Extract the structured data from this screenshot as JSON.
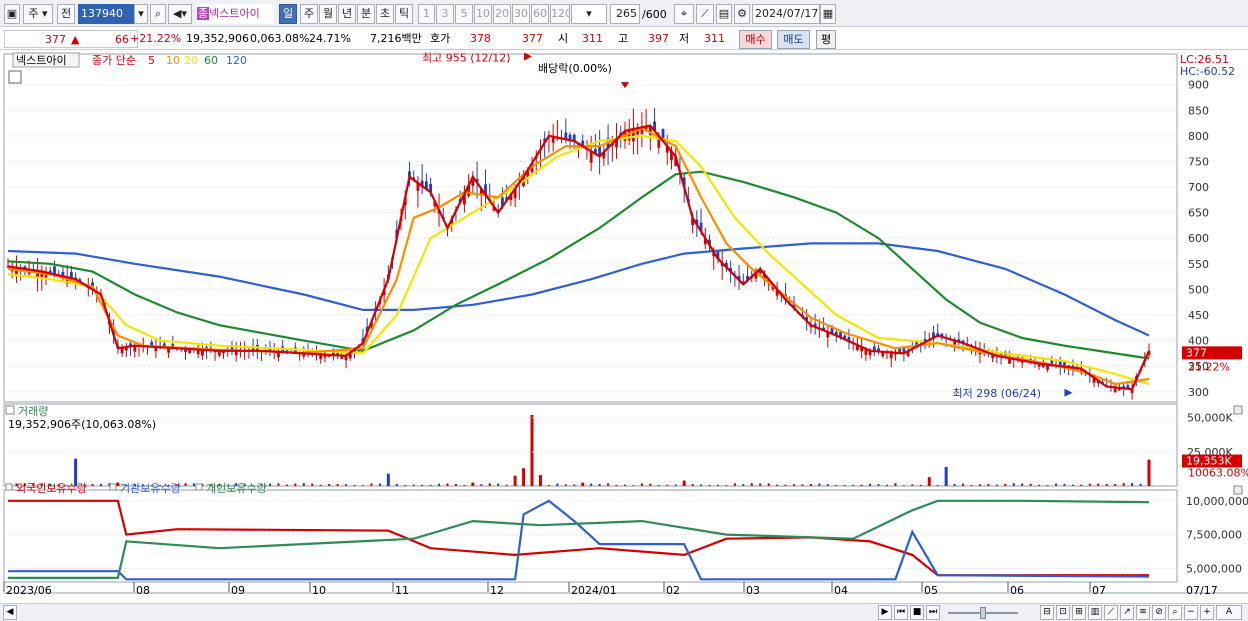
{
  "toolbar": {
    "market_label": "주",
    "prev_label": "전",
    "stock_code": "137940",
    "stock_badge": "종",
    "stock_name": "넥스트아이",
    "period_buttons": [
      "일",
      "주",
      "월",
      "년",
      "분",
      "초",
      "틱"
    ],
    "selected_period": "일",
    "interval_buttons": [
      "1",
      "3",
      "5",
      "10",
      "20",
      "30",
      "60",
      "120"
    ],
    "bar_count": "265",
    "bar_total": "/600",
    "date": "2024/07/17"
  },
  "quote": {
    "price": "377",
    "change": "66",
    "change_pct": "+21.22%",
    "volume": "19,352,906",
    "volume_pct": "0,063.08%",
    "turnover": "24.71%",
    "amount": "7,216백만",
    "quote_label": "호가",
    "ask": "378",
    "bid": "377",
    "open_label": "시",
    "open": "311",
    "high_label": "고",
    "high": "397",
    "low_label": "저",
    "low": "311",
    "buy_label": "매수",
    "sell_label": "매도",
    "eval_label": "평"
  },
  "price_panel": {
    "stock_tag": "넥스트아이",
    "ma_label": "종가 단순",
    "ma_periods": [
      "5",
      "10",
      "20",
      "60",
      "120"
    ],
    "ma_colors": [
      "#d40000",
      "#ff8c00",
      "#f2e600",
      "#1e8a2e",
      "#2f5fd0"
    ],
    "high_marker": "최고 955 (12/12)",
    "dividend_marker": "배당락(0.00%)",
    "low_marker": "최저 298 (06/24)",
    "lc_label": "LC:26.51",
    "hc_label": "HC:-60.52",
    "current_price_tag": "377",
    "current_pct_tag": "21.22%",
    "y_ticks": [
      "900",
      "850",
      "800",
      "750",
      "700",
      "650",
      "600",
      "550",
      "500",
      "450",
      "400",
      "350",
      "300"
    ]
  },
  "volume_panel": {
    "title": "거래량",
    "value_label": "19,352,906주(10,063.08%)",
    "y_ticks": [
      "50,000K",
      "25,000K"
    ],
    "current_tag": "19,353K",
    "current_pct_tag": "10063.08%"
  },
  "holdings_panel": {
    "legend": [
      "외국인보유수량",
      "기관보유수량",
      "개인보유수량"
    ],
    "legend_colors": [
      "#d40000",
      "#2f5fd0",
      "#2e8b57"
    ],
    "y_ticks": [
      "10,000,000",
      "7,500,000",
      "5,000,000"
    ]
  },
  "x_axis": {
    "labels": [
      "2023/06",
      "08",
      "09",
      "10",
      "11",
      "12",
      "2024/01",
      "02",
      "03",
      "04",
      "05",
      "06",
      "07"
    ],
    "end_label": "07/17"
  },
  "chart_data": [
    {
      "type": "candlestick",
      "title": "넥스트아이",
      "ylim": [
        280,
        960
      ],
      "annotations": [
        {
          "label": "최고 955 (12/12)",
          "value": 955
        },
        {
          "label": "배당락(0.00%)"
        },
        {
          "label": "최저 298 (06/24)",
          "value": 298
        }
      ],
      "series": [
        {
          "name": "5",
          "points": [
            [
              0,
              545
            ],
            [
              8,
              535
            ],
            [
              16,
              520
            ],
            [
              22,
              490
            ],
            [
              26,
              385
            ],
            [
              30,
              390
            ],
            [
              40,
              385
            ],
            [
              50,
              380
            ],
            [
              60,
              380
            ],
            [
              70,
              375
            ],
            [
              80,
              370
            ],
            [
              84,
              395
            ],
            [
              90,
              520
            ],
            [
              95,
              720
            ],
            [
              100,
              690
            ],
            [
              104,
              620
            ],
            [
              110,
              720
            ],
            [
              116,
              650
            ],
            [
              122,
              720
            ],
            [
              128,
              800
            ],
            [
              134,
              790
            ],
            [
              140,
              760
            ],
            [
              146,
              810
            ],
            [
              152,
              820
            ],
            [
              158,
              760
            ],
            [
              162,
              640
            ],
            [
              168,
              560
            ],
            [
              174,
              510
            ],
            [
              178,
              540
            ],
            [
              184,
              480
            ],
            [
              190,
              430
            ],
            [
              196,
              410
            ],
            [
              204,
              380
            ],
            [
              212,
              375
            ],
            [
              220,
              410
            ],
            [
              226,
              395
            ],
            [
              234,
              370
            ],
            [
              244,
              355
            ],
            [
              254,
              345
            ],
            [
              260,
              310
            ],
            [
              266,
              305
            ],
            [
              270,
              380
            ]
          ]
        },
        {
          "name": "10",
          "points": [
            [
              0,
              540
            ],
            [
              10,
              530
            ],
            [
              20,
              505
            ],
            [
              26,
              410
            ],
            [
              32,
              390
            ],
            [
              50,
              382
            ],
            [
              70,
              376
            ],
            [
              84,
              385
            ],
            [
              92,
              520
            ],
            [
              96,
              640
            ],
            [
              102,
              660
            ],
            [
              108,
              690
            ],
            [
              116,
              680
            ],
            [
              124,
              740
            ],
            [
              132,
              780
            ],
            [
              140,
              780
            ],
            [
              150,
              815
            ],
            [
              158,
              780
            ],
            [
              164,
              680
            ],
            [
              170,
              590
            ],
            [
              176,
              540
            ],
            [
              182,
              500
            ],
            [
              190,
              445
            ],
            [
              198,
              415
            ],
            [
              210,
              385
            ],
            [
              220,
              395
            ],
            [
              232,
              375
            ],
            [
              246,
              355
            ],
            [
              256,
              335
            ],
            [
              262,
              315
            ],
            [
              270,
              325
            ]
          ]
        },
        {
          "name": "20",
          "points": [
            [
              0,
              530
            ],
            [
              10,
              520
            ],
            [
              20,
              505
            ],
            [
              28,
              430
            ],
            [
              36,
              400
            ],
            [
              50,
              390
            ],
            [
              70,
              382
            ],
            [
              84,
              375
            ],
            [
              92,
              450
            ],
            [
              100,
              600
            ],
            [
              110,
              650
            ],
            [
              120,
              700
            ],
            [
              130,
              760
            ],
            [
              140,
              790
            ],
            [
              150,
              800
            ],
            [
              158,
              790
            ],
            [
              164,
              740
            ],
            [
              172,
              640
            ],
            [
              180,
              570
            ],
            [
              188,
              510
            ],
            [
              196,
              450
            ],
            [
              206,
              405
            ],
            [
              220,
              395
            ],
            [
              236,
              375
            ],
            [
              250,
              360
            ],
            [
              262,
              335
            ],
            [
              270,
              315
            ]
          ]
        },
        {
          "name": "60",
          "points": [
            [
              0,
              555
            ],
            [
              10,
              550
            ],
            [
              20,
              535
            ],
            [
              30,
              490
            ],
            [
              40,
              455
            ],
            [
              50,
              430
            ],
            [
              60,
              415
            ],
            [
              70,
              400
            ],
            [
              84,
              380
            ],
            [
              96,
              420
            ],
            [
              106,
              470
            ],
            [
              116,
              510
            ],
            [
              128,
              560
            ],
            [
              140,
              620
            ],
            [
              150,
              680
            ],
            [
              158,
              725
            ],
            [
              164,
              730
            ],
            [
              174,
              710
            ],
            [
              186,
              680
            ],
            [
              196,
              650
            ],
            [
              206,
              600
            ],
            [
              214,
              540
            ],
            [
              222,
              480
            ],
            [
              230,
              435
            ],
            [
              240,
              405
            ],
            [
              250,
              390
            ],
            [
              262,
              375
            ],
            [
              270,
              365
            ]
          ]
        },
        {
          "name": "120",
          "points": [
            [
              0,
              575
            ],
            [
              16,
              570
            ],
            [
              30,
              550
            ],
            [
              50,
              525
            ],
            [
              70,
              490
            ],
            [
              84,
              460
            ],
            [
              96,
              460
            ],
            [
              110,
              470
            ],
            [
              124,
              490
            ],
            [
              138,
              520
            ],
            [
              150,
              550
            ],
            [
              160,
              570
            ],
            [
              174,
              580
            ],
            [
              190,
              590
            ],
            [
              206,
              590
            ],
            [
              220,
              575
            ],
            [
              236,
              540
            ],
            [
              250,
              490
            ],
            [
              262,
              440
            ],
            [
              270,
              410
            ]
          ]
        }
      ]
    },
    {
      "type": "bar",
      "title": "거래량",
      "ylim": [
        0,
        60000
      ],
      "y_unit": "K",
      "values": [
        [
          16,
          20000
        ],
        [
          26,
          2500
        ],
        [
          90,
          9000
        ],
        [
          110,
          2500
        ],
        [
          120,
          7500
        ],
        [
          122,
          13000
        ],
        [
          124,
          52000
        ],
        [
          126,
          8000
        ],
        [
          136,
          2500
        ],
        [
          160,
          4000
        ],
        [
          218,
          6500
        ],
        [
          222,
          14000
        ],
        [
          270,
          19353
        ]
      ]
    },
    {
      "type": "line",
      "title": "외국인/기관/개인 보유수량",
      "ylim": [
        4000000,
        10800000
      ],
      "series": [
        {
          "name": "외국인보유수량",
          "points": [
            [
              0,
              10000000
            ],
            [
              26,
              10000000
            ],
            [
              28,
              7500000
            ],
            [
              40,
              7900000
            ],
            [
              90,
              7800000
            ],
            [
              100,
              6500000
            ],
            [
              120,
              6000000
            ],
            [
              140,
              6500000
            ],
            [
              160,
              6000000
            ],
            [
              170,
              7200000
            ],
            [
              190,
              7300000
            ],
            [
              204,
              7000000
            ],
            [
              214,
              6000000
            ],
            [
              220,
              4500000
            ],
            [
              270,
              4500000
            ]
          ]
        },
        {
          "name": "기관보유수량",
          "points": [
            [
              0,
              4800000
            ],
            [
              26,
              4800000
            ],
            [
              28,
              4200000
            ],
            [
              120,
              4200000
            ],
            [
              122,
              9000000
            ],
            [
              128,
              10000000
            ],
            [
              134,
              8500000
            ],
            [
              140,
              6800000
            ],
            [
              160,
              6800000
            ],
            [
              164,
              4200000
            ],
            [
              210,
              4200000
            ],
            [
              214,
              7700000
            ],
            [
              220,
              4500000
            ],
            [
              270,
              4400000
            ]
          ]
        },
        {
          "name": "개인보유수량",
          "points": [
            [
              0,
              4300000
            ],
            [
              26,
              4300000
            ],
            [
              28,
              7000000
            ],
            [
              50,
              6500000
            ],
            [
              96,
              7200000
            ],
            [
              110,
              8500000
            ],
            [
              126,
              8200000
            ],
            [
              150,
              8500000
            ],
            [
              170,
              7500000
            ],
            [
              200,
              7200000
            ],
            [
              214,
              9300000
            ],
            [
              220,
              10000000
            ],
            [
              240,
              10000000
            ],
            [
              270,
              9900000
            ]
          ]
        }
      ]
    }
  ]
}
